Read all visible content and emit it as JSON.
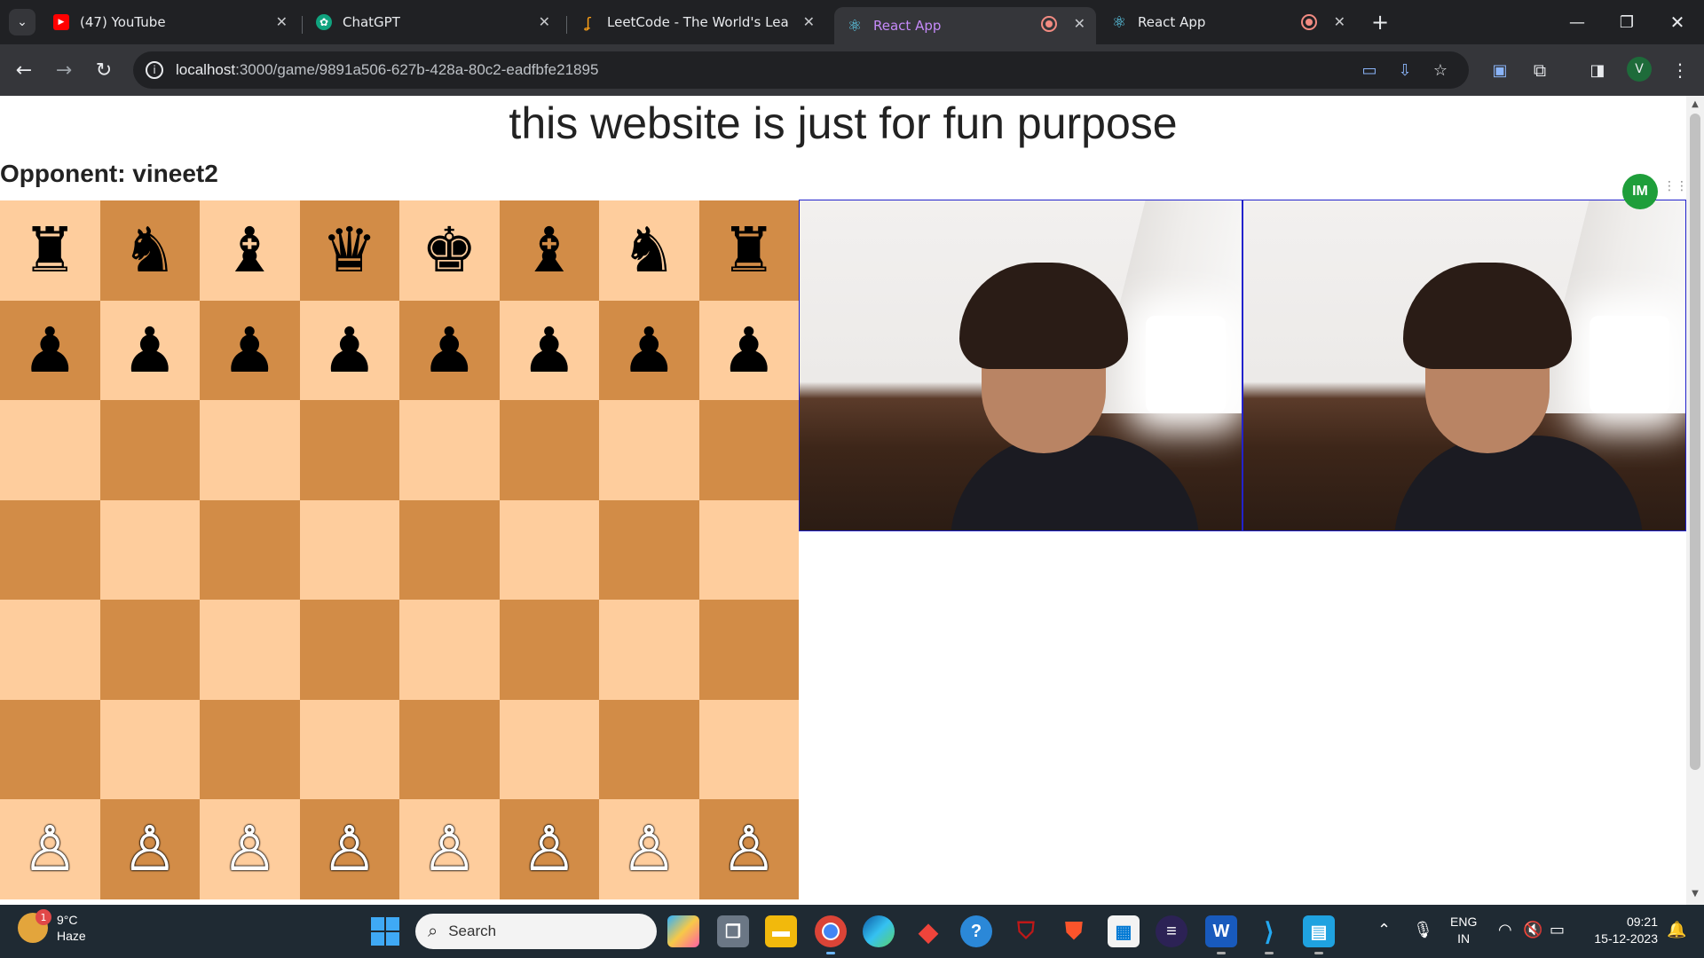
{
  "browser": {
    "tabs": [
      {
        "label": "(47) YouTube",
        "icon": "youtube-icon",
        "active": false
      },
      {
        "label": "ChatGPT",
        "icon": "chatgpt-icon",
        "active": false
      },
      {
        "label": "LeetCode - The World's Leading",
        "icon": "leetcode-icon",
        "active": false
      },
      {
        "label": "React App",
        "icon": "react-icon",
        "active": true
      },
      {
        "label": "React App",
        "icon": "react-icon",
        "active": false
      }
    ],
    "new_tab": "+",
    "url_host": "localhost",
    "url_path": ":3000/game/9891a506-627b-428a-80c2-eadfbfe21895",
    "profile_initial": "V"
  },
  "page": {
    "heading": "this website is just for fun purpose",
    "opponent_label": "Opponent: vineet2",
    "ext_badge": "IM"
  },
  "board": {
    "light_color": "#fecd9d",
    "dark_color": "#d28c47",
    "rows": [
      [
        "♜",
        "♞",
        "♝",
        "♛",
        "♚",
        "♝",
        "♞",
        "♜"
      ],
      [
        "♟",
        "♟",
        "♟",
        "♟",
        "♟",
        "♟",
        "♟",
        "♟"
      ],
      [
        "",
        "",
        "",
        "",
        "",
        "",
        "",
        ""
      ],
      [
        "",
        "",
        "",
        "",
        "",
        "",
        "",
        ""
      ],
      [
        "",
        "",
        "",
        "",
        "",
        "",
        "",
        ""
      ],
      [
        "",
        "",
        "",
        "",
        "",
        "",
        "",
        ""
      ],
      [
        "♙",
        "♙",
        "♙",
        "♙",
        "♙",
        "♙",
        "♙",
        "♙"
      ]
    ]
  },
  "videos": [
    {
      "name": "local-video"
    },
    {
      "name": "remote-video"
    }
  ],
  "taskbar": {
    "weather_temp": "9°C",
    "weather_desc": "Haze",
    "weather_badge": "1",
    "search_placeholder": "Search",
    "lang_top": "ENG",
    "lang_bottom": "IN",
    "time": "09:21",
    "date": "15-12-2023"
  }
}
